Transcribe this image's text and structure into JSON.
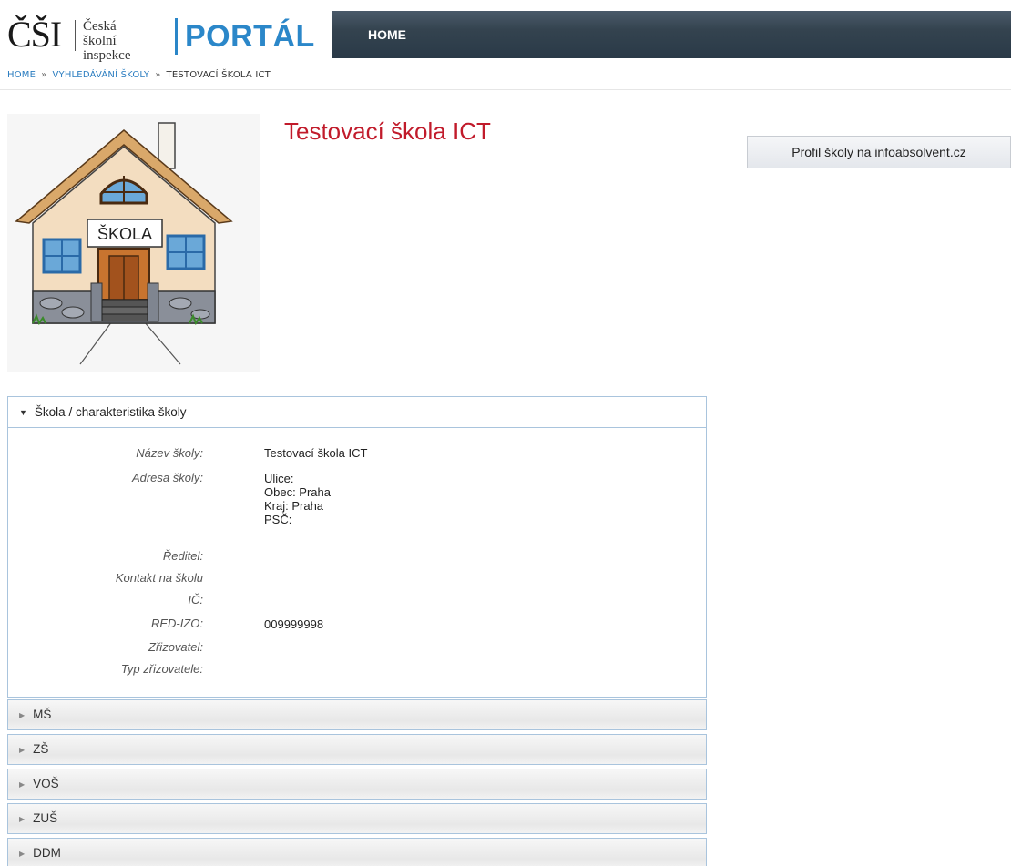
{
  "logo": {
    "csi": "ČŠI",
    "line1": "Česká školní",
    "line2": "inspekce",
    "portal": "PORTÁL"
  },
  "nav": {
    "home": "HOME"
  },
  "breadcrumb": {
    "items": [
      "HOME",
      "VYHLEDÁVÁNÍ ŠKOLY"
    ],
    "current": "TESTOVACÍ ŠKOLA ICT"
  },
  "school": {
    "title": "Testovací škola ICT",
    "image_sign": "ŠKOLA"
  },
  "profile_button": "Profil školy na infoabsolvent.cz",
  "section_open": {
    "title": "Škola / charakteristika školy",
    "fields": {
      "nazev_label": "Název školy:",
      "nazev_value": "Testovací škola ICT",
      "adresa_label": "Adresa školy:",
      "adresa_lines": [
        "Ulice:",
        "Obec: Praha",
        "Kraj: Praha",
        "PSČ:"
      ],
      "reditel_label": "Ředitel:",
      "kontakt_label": "Kontakt na školu",
      "ic_label": "IČ:",
      "redizo_label": "RED-IZO:",
      "redizo_value": "009999998",
      "zrizovatel_label": "Zřizovatel:",
      "typ_label": "Typ zřizovatele:"
    }
  },
  "sections_closed": [
    "MŠ",
    "ZŠ",
    "VOŠ",
    "ZUŠ",
    "DDM"
  ],
  "colors": {
    "accent_blue": "#2b87c9",
    "title_red": "#c11b2b",
    "nav_dark": "#34434f"
  }
}
